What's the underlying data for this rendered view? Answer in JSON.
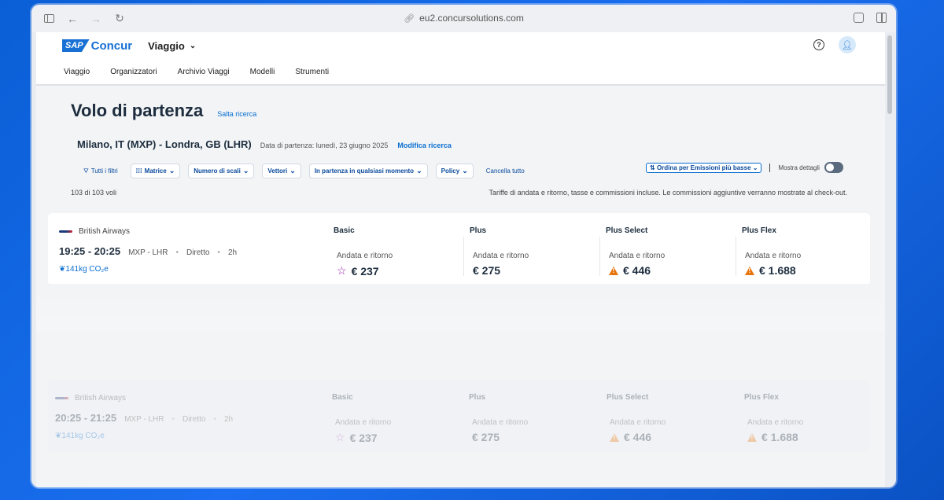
{
  "browser": {
    "url": "eu2.concursolutions.com"
  },
  "header": {
    "brand_sap": "SAP",
    "brand_concur": "Concur",
    "app_switcher": "Viaggio",
    "help_icon": "question-circle-icon",
    "user_icon": "user-icon"
  },
  "nav": {
    "items": [
      "Viaggio",
      "Organizzatori",
      "Archivio Viaggi",
      "Modelli",
      "Strumenti"
    ]
  },
  "page": {
    "title": "Volo di partenza",
    "skip_link": "Salta ricerca",
    "route": "Milano, IT (MXP) - Londra, GB (LHR)",
    "departure_date": "Data di partenza: lunedì, 23 giugno 2025",
    "modify_link": "Modifica ricerca"
  },
  "filters": {
    "all": "Tutti i filtri",
    "matrix": "Matrice",
    "stops": "Numero di scali",
    "carriers": "Vettori",
    "departure": "In partenza in qualsiasi momento",
    "policy": "Policy",
    "clear": "Cancella tutto"
  },
  "sort": {
    "label": "Ordina per Emissioni più basse",
    "details_label": "Mostra dettagli"
  },
  "results": {
    "count": "103 di 103 voli",
    "fare_note": "Tariffe di andata e ritorno, tasse e commissioni incluse. Le commissioni aggiuntive verranno mostrate al check-out."
  },
  "flights": [
    {
      "airline": "British Airways",
      "times": "19:25 - 20:25",
      "route": "MXP - LHR",
      "stops": "Diretto",
      "duration": "2h",
      "co2": "141kg CO₂e",
      "fares": [
        {
          "name": "Basic",
          "sub": "Andata e ritorno",
          "price": "€ 237",
          "icon": "star-icon"
        },
        {
          "name": "Plus",
          "sub": "Andata e ritorno",
          "price": "€ 275",
          "icon": ""
        },
        {
          "name": "Plus Select",
          "sub": "Andata e ritorno",
          "price": "€ 446",
          "icon": "warning-icon"
        },
        {
          "name": "Plus Flex",
          "sub": "Andata e ritorno",
          "price": "€ 1.688",
          "icon": "warning-icon"
        }
      ]
    },
    {
      "airline": "British Airways",
      "times": "20:25 - 21:25",
      "route": "MXP - LHR",
      "stops": "Diretto",
      "duration": "2h",
      "co2": "141kg CO₂e",
      "fares": [
        {
          "name": "Basic",
          "sub": "Andata e ritorno",
          "price": "€ 237",
          "icon": "star-icon"
        },
        {
          "name": "Plus",
          "sub": "Andata e ritorno",
          "price": "€ 275",
          "icon": ""
        },
        {
          "name": "Plus Select",
          "sub": "Andata e ritorno",
          "price": "€ 446",
          "icon": "warning-icon"
        },
        {
          "name": "Plus Flex",
          "sub": "Andata e ritorno",
          "price": "€ 1.688",
          "icon": "warning-icon"
        }
      ]
    }
  ]
}
